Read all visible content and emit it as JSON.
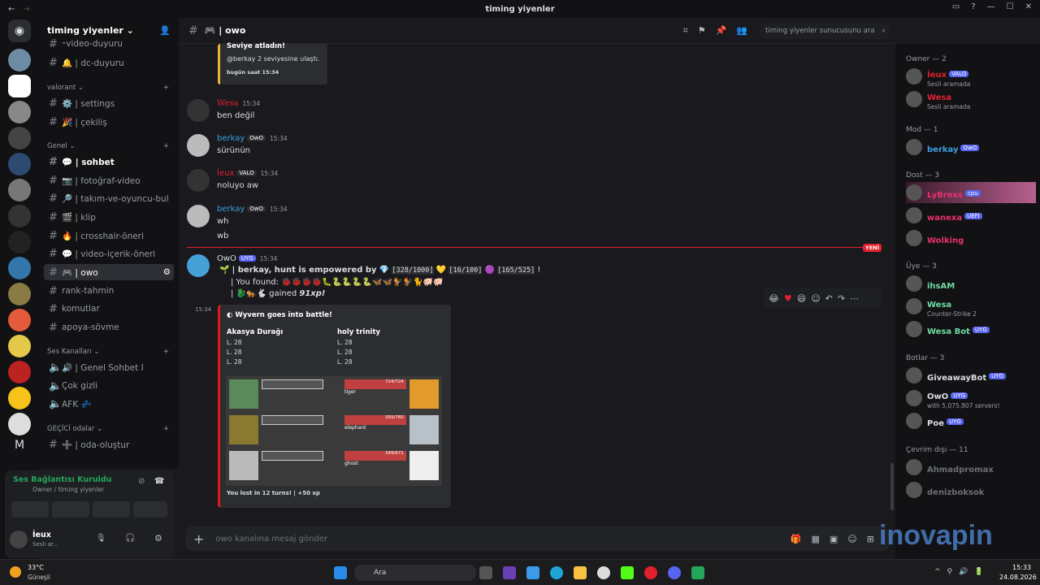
{
  "window": {
    "title": "timing yiyenler"
  },
  "guild": {
    "name": "timing yiyenler ⌄"
  },
  "channels": {
    "top": [
      {
        "label": "⁃video-duyuru"
      },
      {
        "label": "🔔 | dc-duyuru"
      }
    ],
    "cat_valorant": "valorant ⌄",
    "valorant": [
      {
        "label": "⚙️ | settings"
      },
      {
        "label": "🎉 | çekiliş"
      }
    ],
    "cat_genel": "Genel ⌄",
    "genel": [
      {
        "label": "💬 | sohbet"
      },
      {
        "label": "📷 | fotoğraf-video"
      },
      {
        "label": "🔎 | takım-ve-oyuncu-bul"
      },
      {
        "label": "🎬 | klip"
      },
      {
        "label": "🔥 | crosshair-öneri"
      },
      {
        "label": "💬 | video-içerik-öneri"
      },
      {
        "label": "🎮 | owo"
      },
      {
        "label": "rank-tahmin"
      },
      {
        "label": "komutlar"
      },
      {
        "label": "apoya-sövme"
      }
    ],
    "cat_ses": "Ses Kanalları ⌄",
    "ses": [
      {
        "label": "🔊 | Genel Sohbet I"
      },
      {
        "label": "Çok gizli"
      },
      {
        "label": "AFK 💤"
      }
    ],
    "cat_gecici": "GEÇİCİ odalar ⌄",
    "gecici": [
      {
        "label": "➕ | oda-oluştur"
      }
    ]
  },
  "voice": {
    "status": "Ses Bağlantısı Kuruldu",
    "sub": "Owner / timing yiyenler",
    "user": "İeux",
    "user_sub": "Sesli ar..."
  },
  "header": {
    "channel": "🎮 | owo",
    "search_placeholder": "timing yiyenler sunucusunu ara"
  },
  "messages": {
    "level_title": "Seviye atladın!",
    "level_text": "@berkay 2 seviyesine ulaştı.",
    "level_time": "bugün saat 15:34",
    "m1": {
      "author": "Wesa",
      "time": "15:34",
      "text": "ben değil"
    },
    "m2": {
      "author": "berkay",
      "badge": "OwO",
      "time": "15:34",
      "text": "sürünün"
    },
    "m3": {
      "author": "İeux",
      "badge": "VALO",
      "time": "15:34",
      "text": "noluyo aw"
    },
    "m4": {
      "author": "berkay",
      "badge": "OwO",
      "time": "15:34",
      "text1": "wh",
      "text2": "wb"
    },
    "new_label": "YENİ",
    "m5": {
      "author": "OwO",
      "badge": "UYG",
      "time": "15:34",
      "line1_a": "| berkay, hunt is empowered by",
      "line1_b": "[328/1000]",
      "line1_c": "[16/100]",
      "line1_d": "[165/525]",
      "line1_e": "!",
      "line2": "| You found:",
      "line3_a": "| ",
      "line3_b": "gained",
      "line3_c": "91xp!",
      "time2": "15:34",
      "embed_title": "Wyvern goes into battle!",
      "team1": "Akasya Durağı",
      "team2": "holy trinity",
      "lvl": [
        "L. 28",
        "L. 28",
        "L. 28"
      ],
      "footer": "You lost in 12 turns! | +50 xp",
      "enemies": [
        "tiger",
        "elephant",
        "ghost"
      ],
      "enemy_hp": [
        "724/724",
        "359/780",
        "349/671"
      ]
    }
  },
  "composer": {
    "placeholder": "owo kanalına mesaj gönder"
  },
  "members": {
    "owner_cat": "Owner — 2",
    "mod_cat": "Mod — 1",
    "dost_cat": "Dost — 3",
    "uye_cat": "Üye — 3",
    "bot_cat": "Botlar — 3",
    "off_cat": "Çevrim dışı — 11",
    "list": [
      {
        "name": "İeux",
        "badge": "VALO",
        "sub": "Sesli aramada",
        "color": "#e2202f"
      },
      {
        "name": "Wesa",
        "badge": "",
        "sub": "Sesli aramada",
        "color": "#e2202f"
      },
      {
        "name": "berkay",
        "badge": "OwO",
        "sub": "",
        "color": "#3aa0e0"
      },
      {
        "name": "LyBrexs",
        "badge": "cpu",
        "sub": "",
        "color": "#e9306e"
      },
      {
        "name": "wanexa",
        "badge": "UEFI",
        "sub": "",
        "color": "#e9306e"
      },
      {
        "name": "Wolking",
        "badge": "",
        "sub": "",
        "color": "#e9306e"
      },
      {
        "name": "ihsAM",
        "badge": "",
        "sub": "",
        "color": "#6fdca3"
      },
      {
        "name": "Wesa",
        "badge": "",
        "sub": "Counter-Strike 2",
        "color": "#6fdca3"
      },
      {
        "name": "Wesa Bot",
        "badge": "UYG",
        "sub": "",
        "color": "#6fdca3"
      },
      {
        "name": "GiveawayBot",
        "badge": "UYG",
        "sub": "",
        "color": "#dbdee1"
      },
      {
        "name": "OwO",
        "badge": "UYG",
        "sub": "with 5,075,807 servers!",
        "color": "#dbdee1"
      },
      {
        "name": "Poe",
        "badge": "UYG",
        "sub": "",
        "color": "#dbdee1"
      },
      {
        "name": "Ahmadpromax",
        "badge": "",
        "sub": "",
        "color": "#6b6f78"
      },
      {
        "name": "denizboksok",
        "badge": "",
        "sub": "",
        "color": "#6b6f78"
      }
    ]
  },
  "watermark": "inovapin",
  "taskbar": {
    "temp": "33°C",
    "weather": "Güneşli",
    "search": "Ara",
    "time": "15:33",
    "date": "24.08.2026"
  },
  "colors": {
    "accent": "#5865f2",
    "red": "#e2202f",
    "green": "#23a55a"
  }
}
